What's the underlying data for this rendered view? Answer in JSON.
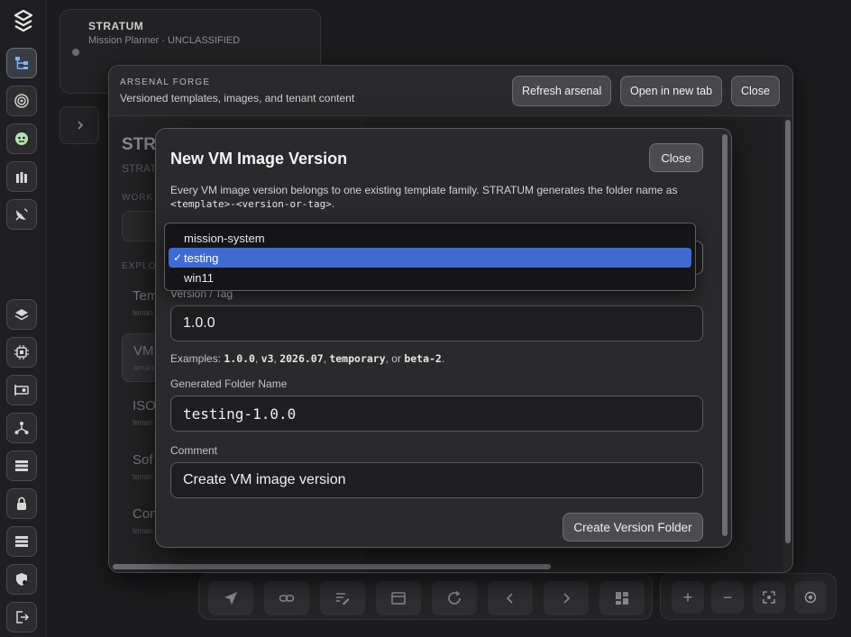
{
  "background": {
    "app_name": "STRATUM",
    "app_subtitle": "Mission Planner · UNCLASSIFIED",
    "left_panel": {
      "title": "STR",
      "subtitle": "STRAT",
      "section_workspace": "WORK",
      "section_explore": "EXPLO",
      "items": [
        {
          "name": "Tem",
          "tenant": "tenan"
        },
        {
          "name": "VM",
          "tenant": "tenan"
        },
        {
          "name": "ISO",
          "tenant": "tenan"
        },
        {
          "name": "Sof",
          "tenant": "tenan"
        },
        {
          "name": "Con",
          "tenant": "tenan"
        }
      ]
    }
  },
  "forge": {
    "title": "ARSENAL FORGE",
    "subtitle": "Versioned templates, images, and tenant content",
    "buttons": {
      "refresh": "Refresh arsenal",
      "open_new_tab": "Open in new tab",
      "close": "Close"
    }
  },
  "modal": {
    "title": "New VM Image Version",
    "close_label": "Close",
    "description_prefix": "Every VM image version belongs to one existing template family. STRATUM generates the folder name as ",
    "description_code": "<template>-<version-or-tag>",
    "description_suffix": ".",
    "version_label": "Version / Tag",
    "version_value": "1.0.0",
    "examples_prefix": "Examples: ",
    "examples": [
      "1.0.0",
      "v3",
      "2026.07",
      "temporary",
      "beta-2"
    ],
    "folder_label": "Generated Folder Name",
    "folder_value": "testing-1.0.0",
    "comment_label": "Comment",
    "comment_value": "Create VM image version",
    "create_label": "Create Version Folder"
  },
  "template_dropdown": {
    "options": [
      "mission-system",
      "testing",
      "win11"
    ],
    "selected": "testing",
    "check_glyph": "✓"
  }
}
